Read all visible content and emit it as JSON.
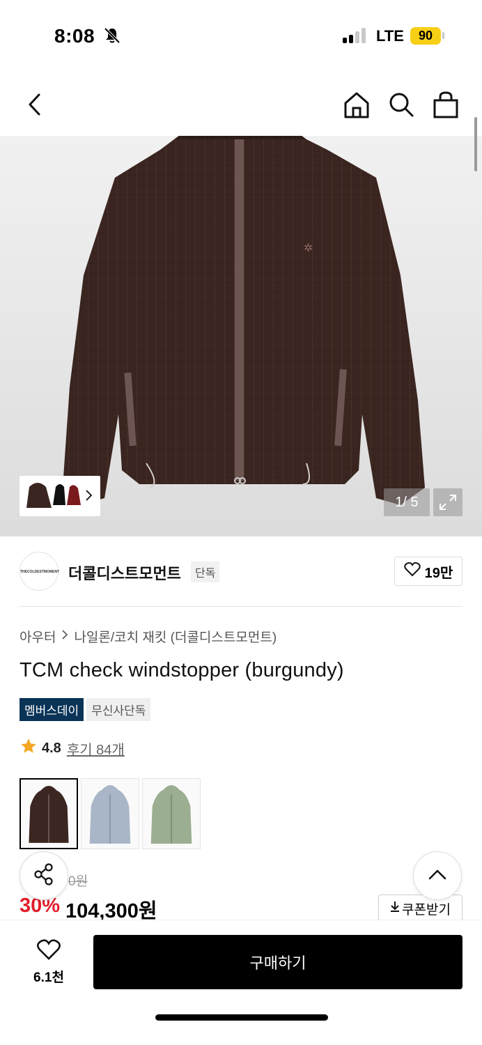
{
  "status_bar": {
    "time": "8:08",
    "network": "LTE",
    "battery": "90",
    "battery_color": "#f7cf15"
  },
  "nav": {
    "back_icon": "chevron-left-icon",
    "home_icon": "home-icon",
    "search_icon": "search-icon",
    "cart_icon": "shopping-bag-icon"
  },
  "gallery": {
    "counter": "1/ 5",
    "thumb_strip_icon": "chevron-right-icon",
    "expand_icon": "expand-icon"
  },
  "brand": {
    "logo_text": "THECOLDESTMOMENT",
    "name": "더콜디스트모먼트",
    "tag": "단독",
    "like_count": "19만"
  },
  "breadcrumb": {
    "category": "아우터",
    "subcategory": "나일론/코치 재킷 (더콜디스트모먼트)"
  },
  "product": {
    "title": "TCM check windstopper (burgundy)",
    "badges": [
      "멤버스데이",
      "무신사단독"
    ],
    "rating": "4.8",
    "reviews": "후기 84개",
    "original_price_partial": "0원",
    "discount": "30%",
    "price": "104,300원",
    "coupon_label": "쿠폰받기",
    "accent_color": "#e21c2a",
    "badge_color": "#0a3357"
  },
  "color_options": [
    {
      "name": "burgundy",
      "color": "#3b2621",
      "selected": true
    },
    {
      "name": "blue",
      "color": "#a9b6c7",
      "selected": false
    },
    {
      "name": "green",
      "color": "#9cae91",
      "selected": false
    }
  ],
  "bottom_bar": {
    "wish_count": "6.1천",
    "buy_label": "구매하기"
  }
}
